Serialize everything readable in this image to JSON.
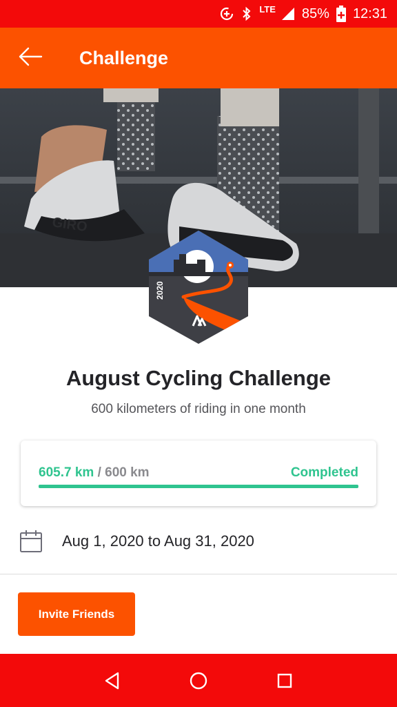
{
  "status_bar": {
    "lte": "LTE",
    "battery": "85%",
    "time": "12:31",
    "icons": [
      "data-saver-icon",
      "bluetooth-icon",
      "signal-icon",
      "battery-icon"
    ]
  },
  "app_bar": {
    "title": "Challenge",
    "back_icon": "arrow-left-icon"
  },
  "badge": {
    "year": "2020"
  },
  "challenge": {
    "title": "August Cycling Challenge",
    "subtitle": "600 kilometers of riding in one month"
  },
  "progress": {
    "current": "605.7 km",
    "separator": "/",
    "goal": "600 km",
    "status": "Completed",
    "fraction": 1.0
  },
  "dates": {
    "range": "Aug 1, 2020 to Aug 31, 2020"
  },
  "actions": {
    "invite_label": "Invite Friends"
  },
  "nav": {
    "icons": [
      "back-triangle-icon",
      "home-circle-icon",
      "recents-square-icon"
    ]
  },
  "colors": {
    "brand_orange": "#fc5200",
    "status_red": "#f30a0a",
    "progress_green": "#2fc48f"
  }
}
